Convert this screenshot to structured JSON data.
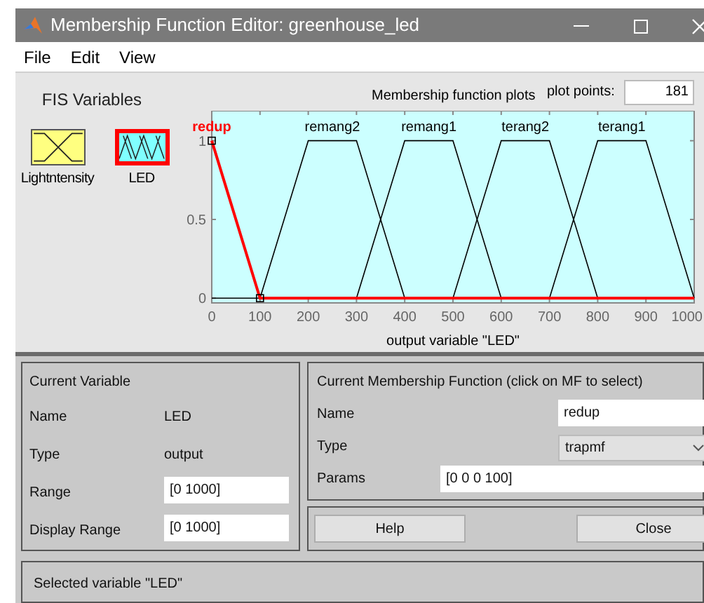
{
  "window": {
    "title": "Membership Function Editor: greenhouse_led"
  },
  "menu": [
    "File",
    "Edit",
    "View"
  ],
  "fis_variables": {
    "title": "FIS Variables",
    "variables": [
      {
        "name": "Lightntensity",
        "kind": "input",
        "selected": false
      },
      {
        "name": "LED",
        "kind": "output",
        "selected": true
      }
    ]
  },
  "plot": {
    "title": "Membership function plots",
    "plot_points_label": "plot points:",
    "plot_points": "181",
    "chart_data": {
      "type": "line",
      "xlabel": "output variable \"LED\"",
      "x": [
        0,
        100,
        200,
        300,
        400,
        500,
        600,
        700,
        800,
        900,
        1000
      ],
      "series": [
        {
          "name": "redup",
          "color": "#ff0000",
          "values": [
            1,
            0,
            0,
            0,
            0,
            0,
            0,
            0,
            0,
            0,
            0
          ]
        },
        {
          "name": "remang2",
          "color": "#000000",
          "values": [
            null,
            0,
            1,
            1,
            0,
            null,
            null,
            null,
            null,
            null,
            null
          ]
        },
        {
          "name": "remang1",
          "color": "#000000",
          "values": [
            null,
            null,
            null,
            0,
            1,
            1,
            0,
            null,
            null,
            null,
            null
          ]
        },
        {
          "name": "terang2",
          "color": "#000000",
          "values": [
            null,
            null,
            null,
            null,
            null,
            0,
            1,
            1,
            0,
            null,
            null
          ]
        },
        {
          "name": "terang1",
          "color": "#000000",
          "values": [
            null,
            null,
            null,
            null,
            null,
            null,
            null,
            0,
            1,
            1,
            0
          ]
        }
      ],
      "xlim": [
        0,
        1000
      ],
      "ylim": [
        -0.03,
        1.19
      ],
      "xticks": [
        0,
        100,
        200,
        300,
        400,
        500,
        600,
        700,
        800,
        900,
        1000
      ],
      "yticks": [
        0,
        0.5,
        1
      ]
    },
    "curves": [
      {
        "selected": true
      },
      {
        "selected": false
      },
      {
        "selected": false
      },
      {
        "selected": false
      },
      {
        "selected": false
      }
    ]
  },
  "current_variable": {
    "title": "Current Variable",
    "fields": [
      {
        "label": "Name",
        "value": "LED",
        "kind": "text"
      },
      {
        "label": "Type",
        "value": "output",
        "kind": "text"
      },
      {
        "label": "Range",
        "value": "[0 1000]",
        "kind": "input"
      },
      {
        "label": "Display Range",
        "value": "[0 1000]",
        "kind": "input"
      }
    ]
  },
  "current_mf": {
    "title": "Current Membership Function (click on MF to select)",
    "name_label": "Name",
    "name": "redup",
    "type_label": "Type",
    "type": "trapmf",
    "params_label": "Params",
    "params": "[0 0 0 100]"
  },
  "buttons": [
    "Help",
    "Close"
  ],
  "status": "Selected variable \"LED\""
}
